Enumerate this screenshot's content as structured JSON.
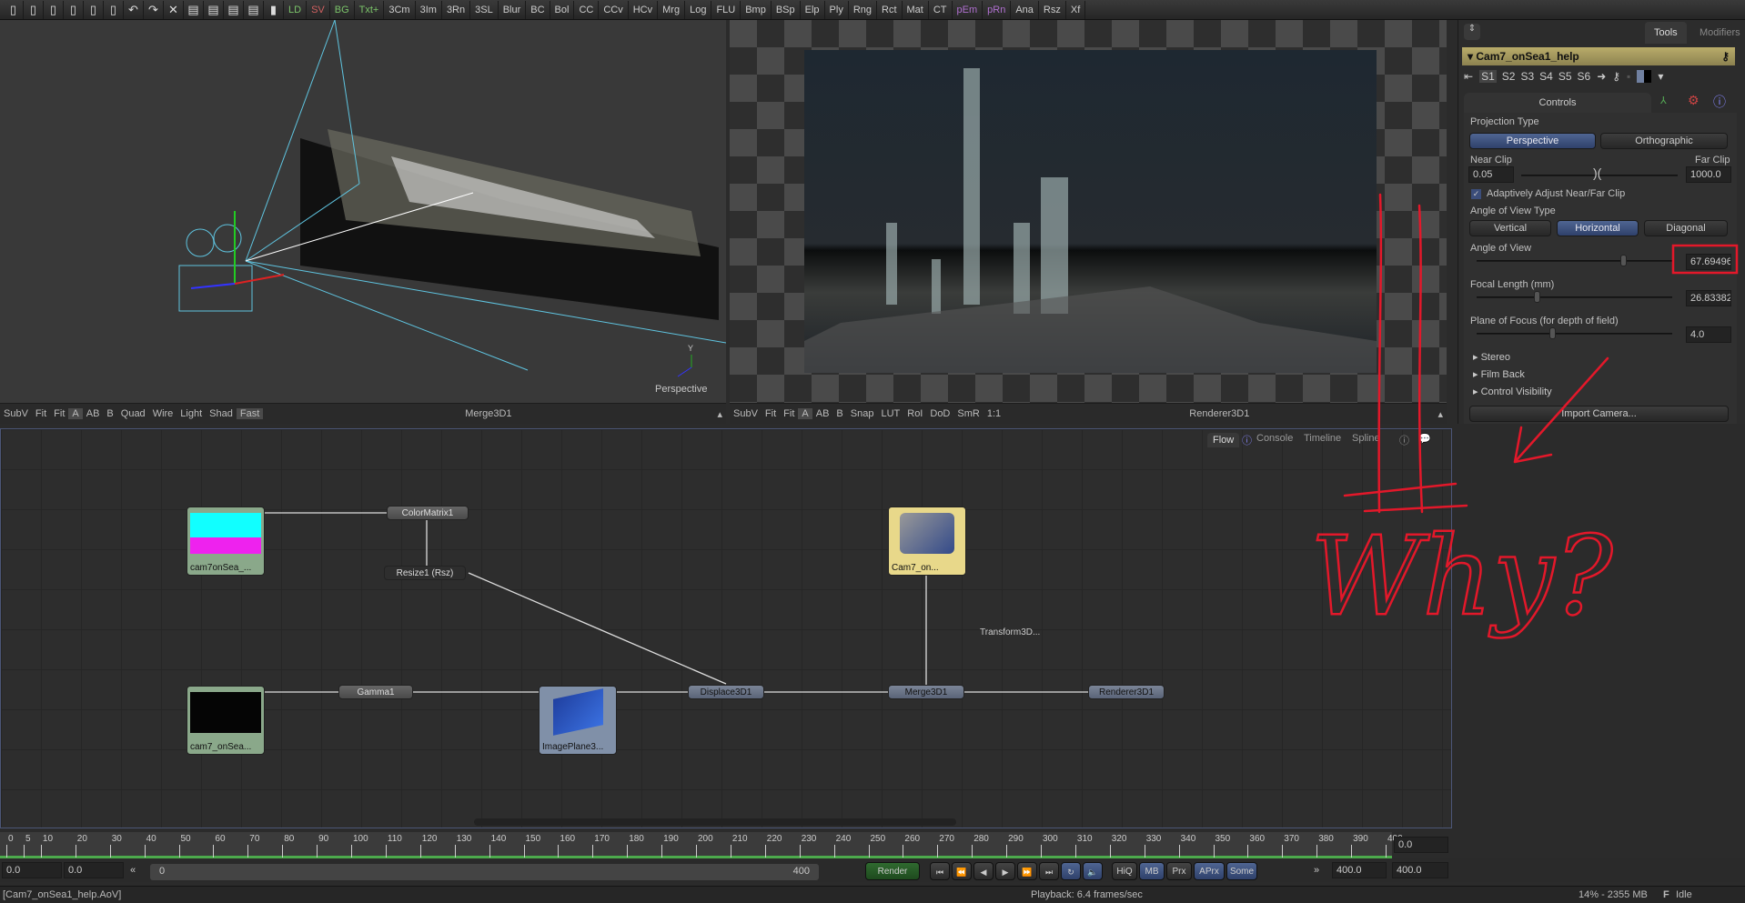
{
  "toolbar": {
    "tools": [
      {
        "l": "LD",
        "c": "g"
      },
      {
        "l": "SV",
        "c": "r"
      },
      {
        "l": "BG",
        "c": "g"
      },
      {
        "l": "Txt+",
        "c": "g"
      },
      {
        "l": "3Cm",
        "c": ""
      },
      {
        "l": "3Im",
        "c": ""
      },
      {
        "l": "3Rn",
        "c": ""
      },
      {
        "l": "3SL",
        "c": ""
      },
      {
        "l": "Blur",
        "c": ""
      },
      {
        "l": "BC",
        "c": ""
      },
      {
        "l": "Bol",
        "c": ""
      },
      {
        "l": "CC",
        "c": ""
      },
      {
        "l": "CCv",
        "c": ""
      },
      {
        "l": "HCv",
        "c": ""
      },
      {
        "l": "Mrg",
        "c": ""
      },
      {
        "l": "Log",
        "c": ""
      },
      {
        "l": "FLU",
        "c": ""
      },
      {
        "l": "Bmp",
        "c": ""
      },
      {
        "l": "BSp",
        "c": ""
      },
      {
        "l": "Elp",
        "c": ""
      },
      {
        "l": "Ply",
        "c": ""
      },
      {
        "l": "Rng",
        "c": ""
      },
      {
        "l": "Rct",
        "c": ""
      },
      {
        "l": "Mat",
        "c": ""
      },
      {
        "l": "CT",
        "c": ""
      },
      {
        "l": "pEm",
        "c": "p"
      },
      {
        "l": "pRn",
        "c": "p"
      },
      {
        "l": "Ana",
        "c": ""
      },
      {
        "l": "Rsz",
        "c": ""
      },
      {
        "l": "Xf",
        "c": ""
      }
    ]
  },
  "viewer_left": {
    "axis_label": "Perspective",
    "axis_y": "Y",
    "bar": [
      "SubV",
      "Fit",
      "Fit",
      "A",
      "AB",
      "B",
      "Quad",
      "Wire",
      "Light",
      "Shad",
      "Fast"
    ],
    "title": "Merge3D1"
  },
  "viewer_right": {
    "bar": [
      "SubV",
      "Fit",
      "Fit",
      "A",
      "AB",
      "B",
      "Snap",
      "LUT",
      "RoI",
      "DoD",
      "SmR",
      "1:1"
    ],
    "title": "Renderer3D1"
  },
  "panel": {
    "tabs": [
      "Tools",
      "Modifiers"
    ],
    "tool_name": "Cam7_onSea1_help",
    "slots": [
      "S1",
      "S2",
      "S3",
      "S4",
      "S5",
      "S6"
    ],
    "controls_tab": "Controls",
    "projection_label": "Projection Type",
    "projection_options": [
      "Perspective",
      "Orthographic"
    ],
    "projection_selected": "Perspective",
    "near_clip_label": "Near Clip",
    "near_clip": "0.05",
    "far_clip_label": "Far Clip",
    "far_clip": "1000.0",
    "adaptive_label": "Adaptively Adjust Near/Far Clip",
    "adaptive_checked": true,
    "aov_type_label": "Angle of View Type",
    "aov_type_options": [
      "Vertical",
      "Horizontal",
      "Diagonal"
    ],
    "aov_type_selected": "Horizontal",
    "aov_label": "Angle of View",
    "aov": "67.69496",
    "focal_label": "Focal Length (mm)",
    "focal": "26.83382",
    "focus_label": "Plane of Focus (for depth of field)",
    "focus": "4.0",
    "sections": [
      "Stereo",
      "Film Back",
      "Control Visibility"
    ],
    "import_button": "Import Camera..."
  },
  "flow": {
    "tabs": [
      "Flow",
      "Console",
      "Timeline",
      "Spline"
    ],
    "nodes": {
      "loader1": "cam7onSea_...",
      "colormatrix": "ColorMatrix1",
      "resize": "Resize1  (Rsz)",
      "camera": "Cam7_on...",
      "transform": "Transform3D...",
      "loader2": "cam7_onSea...",
      "gamma": "Gamma1",
      "imageplane": "ImagePlane3...",
      "displace": "Displace3D1",
      "merge": "Merge3D1",
      "renderer": "Renderer3D1"
    }
  },
  "timeline": {
    "start": 0,
    "end": 400,
    "ticks": [
      0,
      5,
      10,
      20,
      30,
      40,
      50,
      60,
      70,
      80,
      90,
      100,
      110,
      120,
      130,
      140,
      150,
      160,
      170,
      180,
      190,
      200,
      210,
      220,
      230,
      240,
      250,
      260,
      270,
      280,
      290,
      300,
      310,
      320,
      330,
      340,
      350,
      360,
      370,
      380,
      390,
      400
    ],
    "current": "0.0",
    "global_start": "0.0",
    "render_start": "0.0",
    "range_start": "0",
    "range_end": "400",
    "render_end": "400.0",
    "global_end": "400.0",
    "render_button": "Render",
    "buttons": [
      "HiQ",
      "MB",
      "Prx",
      "APrx",
      "Some"
    ]
  },
  "status": {
    "left": "[Cam7_onSea1_help.AoV]",
    "playback": "Playback: 6.4 frames/sec",
    "memory": "14% - 2355 MB",
    "state": "Idle"
  },
  "annotation": {
    "text": "Why?",
    "color": "#e3182a"
  },
  "colors": {
    "accent": "#4f6592",
    "node_header": "#b9ac6a",
    "timeline_green": "#4caa4c"
  }
}
